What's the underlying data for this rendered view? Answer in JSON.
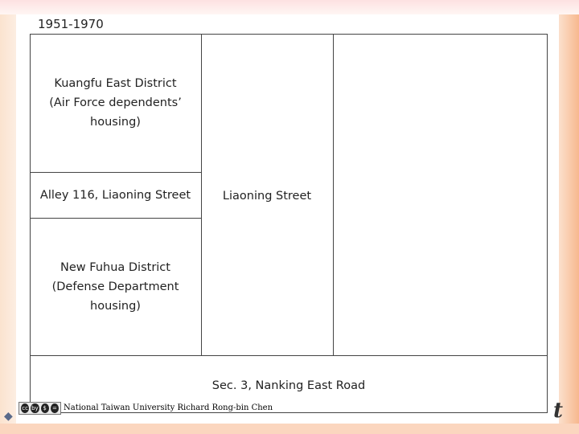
{
  "slide": {
    "title": "1951-1970",
    "cells": {
      "kuangfu": {
        "line1": "Kuangfu  East District",
        "line2": "(Air Force dependents’",
        "line3": "housing)"
      },
      "alley": {
        "label": "Alley 116, Liaoning  Street"
      },
      "new_fuhua": {
        "line1": "New Fuhua  District",
        "line2": "(Defense Department",
        "line3": "housing)"
      },
      "liaoning": {
        "label": "Liaoning  Street"
      },
      "nanking": {
        "label": "Sec. 3, Nanking  East Road"
      }
    }
  },
  "footer": {
    "credit": "National Taiwan University Richard Rong-bin Chen",
    "cc_badge": [
      "cc",
      "by",
      "$",
      "="
    ],
    "logo_right": "t"
  }
}
